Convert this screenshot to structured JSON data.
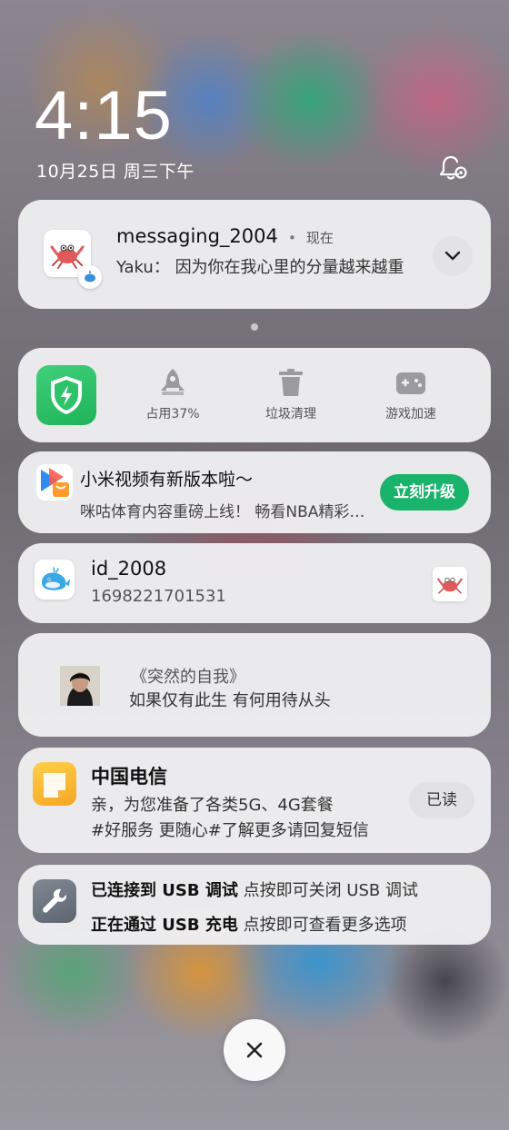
{
  "lockscreen": {
    "time": "4:15",
    "date": "10月25日 周三下午"
  },
  "notifications": {
    "messaging": {
      "app": "messaging_2004",
      "separator": "•",
      "time": "现在",
      "sender": "Yaku：",
      "message": "因为你在我心里的分量越来越重"
    },
    "security": {
      "actions": [
        {
          "label": "占用37%",
          "icon": "rocket-icon"
        },
        {
          "label": "垃圾清理",
          "icon": "trash-icon"
        },
        {
          "label": "游戏加速",
          "icon": "gamepad-icon"
        }
      ]
    },
    "video": {
      "title": "小米视频有新版本啦～",
      "body": "咪咕体育内容重磅上线！ 畅看NBA精彩赛事",
      "button": "立刻升级"
    },
    "id": {
      "title": "id_2008",
      "body": "1698221701531"
    },
    "music": {
      "title": "《突然的自我》",
      "lyric": "如果仅有此生 有何用待从头"
    },
    "telecom": {
      "title": "中国电信",
      "line1": "亲，为您准备了各类5G、4G套餐",
      "line2": "#好服务 更随心#了解更多请回复短信",
      "button": "已读"
    },
    "usb": {
      "line1_bold": "已连接到 USB 调试",
      "line1_rest": " 点按即可关闭 USB 调试",
      "line2_bold": "正在通过 USB 充电",
      "line2_rest": " 点按即可查看更多选项"
    }
  },
  "colors": {
    "accent_green": "#19b36b",
    "shield_green": "#2ec36a",
    "telecom_yellow": "#f7b82a",
    "card_bg": "#f0f0f2"
  }
}
